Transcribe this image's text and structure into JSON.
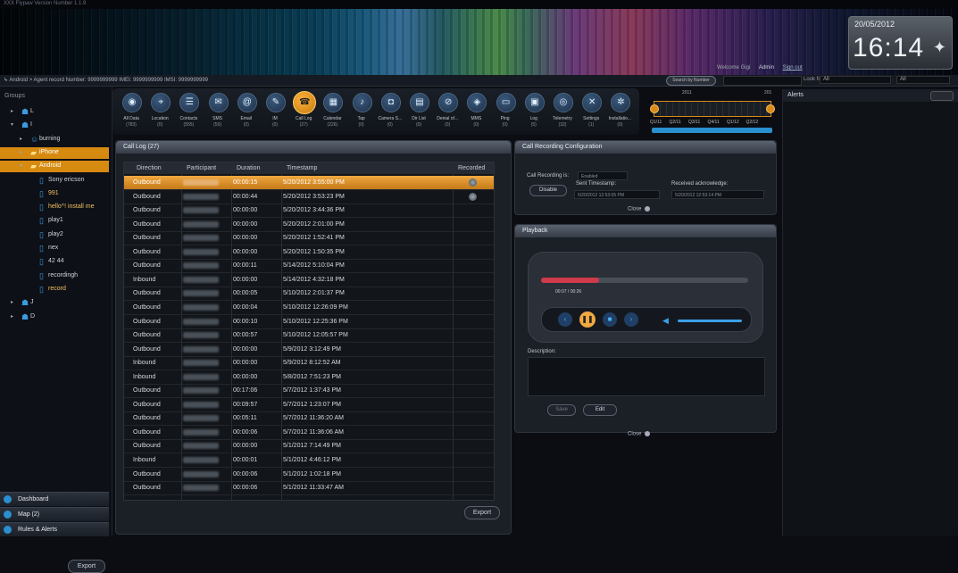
{
  "window": {
    "title": "XXX Flypaw Version Number 1.1.9"
  },
  "clock": {
    "date": "20/05/2012",
    "time": "16:14"
  },
  "user_bar": {
    "welcome": "Welcome Gigi",
    "user": "Admin",
    "sign_out": "Sign out"
  },
  "info_bar": {
    "path": "↳ Android > Agent record  Number: 9999999999   IMEI: 9999999999    IMSI: 9999999999",
    "button": "Search by Number",
    "look_for_label": "Look for:",
    "look_for_value": "All",
    "in_value": "All"
  },
  "sidebar": {
    "groups_label": "Groups",
    "tree": [
      {
        "label": "L",
        "indent": 1,
        "arrow": "▸",
        "icon": "group",
        "selected": false
      },
      {
        "label": "I",
        "indent": 1,
        "arrow": "▾",
        "icon": "group",
        "selected": false
      },
      {
        "label": "burning",
        "indent": 2,
        "arrow": "▸",
        "icon": "person",
        "selected": false
      },
      {
        "label": "iPhone",
        "indent": 2,
        "arrow": "▸",
        "icon": "folder",
        "selected": true
      },
      {
        "label": "Android",
        "indent": 2,
        "arrow": "▾",
        "icon": "folder",
        "selected": true
      },
      {
        "label": "Sony ericson",
        "indent": 3,
        "arrow": "",
        "icon": "phone",
        "selected": false
      },
      {
        "label": "991",
        "indent": 3,
        "arrow": "",
        "icon": "phone",
        "selected": false,
        "highlight": true
      },
      {
        "label": "hello^! install me",
        "indent": 3,
        "arrow": "",
        "icon": "phone",
        "selected": false,
        "highlight": true
      },
      {
        "label": "play1",
        "indent": 3,
        "arrow": "",
        "icon": "phone",
        "selected": false
      },
      {
        "label": "play2",
        "indent": 3,
        "arrow": "",
        "icon": "phone",
        "selected": false
      },
      {
        "label": "nex",
        "indent": 3,
        "arrow": "",
        "icon": "phone",
        "selected": false
      },
      {
        "label": "42 44",
        "indent": 3,
        "arrow": "",
        "icon": "phone",
        "selected": false
      },
      {
        "label": "recordingh",
        "indent": 3,
        "arrow": "",
        "icon": "phone",
        "selected": false
      },
      {
        "label": "record",
        "indent": 3,
        "arrow": "",
        "icon": "phone",
        "selected": false,
        "highlight": true
      },
      {
        "label": "J",
        "indent": 1,
        "arrow": "▸",
        "icon": "group",
        "selected": false
      },
      {
        "label": "D",
        "indent": 1,
        "arrow": "▸",
        "icon": "group",
        "selected": false
      }
    ],
    "export_label": "Export",
    "nav": [
      {
        "label": "Dashboard"
      },
      {
        "label": "Map (2)"
      },
      {
        "label": "Rules & Alerts"
      }
    ]
  },
  "toolbar": [
    {
      "name": "All Data",
      "count": "(783)",
      "glyph": "◉"
    },
    {
      "name": "Location",
      "count": "(0)",
      "glyph": "⌖"
    },
    {
      "name": "Contacts",
      "count": "(555)",
      "glyph": "☰"
    },
    {
      "name": "SMS",
      "count": "(50)",
      "glyph": "✉"
    },
    {
      "name": "Email",
      "count": "(0)",
      "glyph": "@"
    },
    {
      "name": "IM",
      "count": "(0)",
      "glyph": "✎"
    },
    {
      "name": "Call Log",
      "count": "(27)",
      "glyph": "☎",
      "active": true
    },
    {
      "name": "Calendar",
      "count": "(226)",
      "glyph": "▦"
    },
    {
      "name": "Tap",
      "count": "(0)",
      "glyph": "♪"
    },
    {
      "name": "Camera S...",
      "count": "(0)",
      "glyph": "◘"
    },
    {
      "name": "Dir List",
      "count": "(0)",
      "glyph": "▤"
    },
    {
      "name": "Denial of...",
      "count": "(0)",
      "glyph": "⊘"
    },
    {
      "name": "MMS",
      "count": "(0)",
      "glyph": "◈"
    },
    {
      "name": "Ping",
      "count": "(0)",
      "glyph": "▭"
    },
    {
      "name": "Log",
      "count": "(5)",
      "glyph": "▣"
    },
    {
      "name": "Telemetry",
      "count": "(32)",
      "glyph": "◎"
    },
    {
      "name": "Settings",
      "count": "(1)",
      "glyph": "✕"
    },
    {
      "name": "Installatio...",
      "count": "(0)",
      "glyph": "✲"
    }
  ],
  "timeline": {
    "years": [
      "2011",
      "201"
    ],
    "quarters": [
      "Q1/11",
      "Q2/11",
      "Q3/11",
      "Q4/11",
      "Q1/12",
      "Q2/12"
    ]
  },
  "call_log": {
    "title": "Call Log (27)",
    "columns": [
      "Direction",
      "Participant",
      "Duration",
      "Timestamp",
      "Recorded"
    ],
    "rows": [
      {
        "direction": "Outbound",
        "duration": "00:00:15",
        "timestamp": "5/20/2012 3:55:00 PM",
        "recorded": true,
        "selected": true
      },
      {
        "direction": "Outbound",
        "duration": "00:00:44",
        "timestamp": "5/20/2012 3:53:23 PM",
        "recorded": true
      },
      {
        "direction": "Outbound",
        "duration": "00:00:00",
        "timestamp": "5/20/2012 3:44:36 PM"
      },
      {
        "direction": "Outbound",
        "duration": "00:00:00",
        "timestamp": "5/20/2012 2:01:00 PM"
      },
      {
        "direction": "Outbound",
        "duration": "00:00:00",
        "timestamp": "5/20/2012 1:52:41 PM"
      },
      {
        "direction": "Outbound",
        "duration": "00:00:00",
        "timestamp": "5/20/2012 1:50:35 PM"
      },
      {
        "direction": "Outbound",
        "duration": "00:00:11",
        "timestamp": "5/14/2012 5:10:04 PM"
      },
      {
        "direction": "Inbound",
        "duration": "00:00:00",
        "timestamp": "5/14/2012 4:32:18 PM"
      },
      {
        "direction": "Outbound",
        "duration": "00:00:05",
        "timestamp": "5/10/2012 2:01:37 PM"
      },
      {
        "direction": "Outbound",
        "duration": "00:00:04",
        "timestamp": "5/10/2012 12:26:09 PM"
      },
      {
        "direction": "Outbound",
        "duration": "00:00:10",
        "timestamp": "5/10/2012 12:25:36 PM"
      },
      {
        "direction": "Outbound",
        "duration": "00:00:57",
        "timestamp": "5/10/2012 12:05:57 PM"
      },
      {
        "direction": "Outbound",
        "duration": "00:00:00",
        "timestamp": "5/9/2012 3:12:49 PM"
      },
      {
        "direction": "Inbound",
        "duration": "00:00:00",
        "timestamp": "5/9/2012 8:12:52 AM"
      },
      {
        "direction": "Inbound",
        "duration": "00:00:00",
        "timestamp": "5/8/2012 7:51:23 PM"
      },
      {
        "direction": "Outbound",
        "duration": "00:17:06",
        "timestamp": "5/7/2012 1:37:43 PM"
      },
      {
        "direction": "Outbound",
        "duration": "00:09:57",
        "timestamp": "5/7/2012 1:23:07 PM"
      },
      {
        "direction": "Outbound",
        "duration": "00:05:11",
        "timestamp": "5/7/2012 11:36:20 AM"
      },
      {
        "direction": "Outbound",
        "duration": "00:00:06",
        "timestamp": "5/7/2012 11:36:06 AM"
      },
      {
        "direction": "Outbound",
        "duration": "00:00:00",
        "timestamp": "5/1/2012 7:14:49 PM"
      },
      {
        "direction": "Inbound",
        "duration": "00:00:01",
        "timestamp": "5/1/2012 4:46:12 PM"
      },
      {
        "direction": "Outbound",
        "duration": "00:00:06",
        "timestamp": "5/1/2012 1:02:18 PM"
      },
      {
        "direction": "Outbound",
        "duration": "00:00:06",
        "timestamp": "5/1/2012 11:33:47 AM"
      }
    ],
    "export_label": "Export"
  },
  "recording_config": {
    "title": "Call Recording Configuration",
    "recording_label": "Call Recording is:",
    "recording_value": "Enabled",
    "disable_label": "Disable",
    "sent_label": "Sent Timestamp:",
    "sent_value": "5/20/2012 12:53:05 PM",
    "received_label": "Received acknowledge:",
    "received_value": "5/20/2012 12:53:14 PM",
    "close_label": "Close"
  },
  "playback": {
    "title": "Playback",
    "position": "00:07",
    "length": "00:26",
    "progress_fraction": 0.28,
    "description_label": "Description:",
    "description_value": "",
    "save_label": "Save",
    "edit_label": "Edit",
    "close_label": "Close"
  },
  "alerts": {
    "title": "Alerts"
  },
  "colors": {
    "accent": "#d68a10",
    "blue": "#2a8fd0",
    "record_red": "#d03a4a"
  }
}
